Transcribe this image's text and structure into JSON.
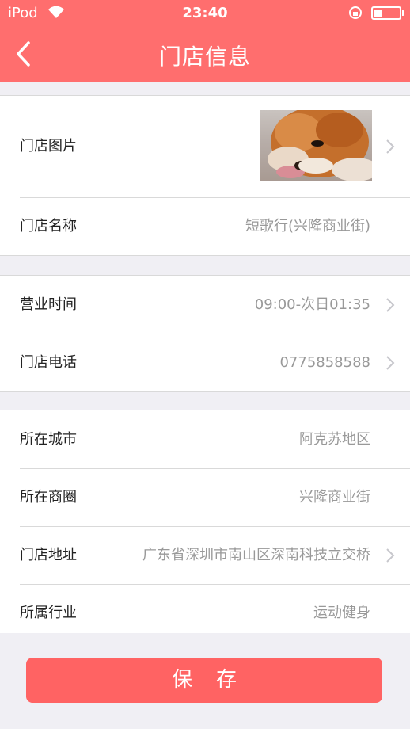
{
  "status_bar": {
    "carrier": "iPod",
    "time": "23:40"
  },
  "nav": {
    "title": "门店信息"
  },
  "groups": [
    [
      {
        "label": "门店图片",
        "value": "",
        "arrow": true
      },
      {
        "label": "门店名称",
        "value": "短歌行(兴隆商业街)",
        "arrow": false
      }
    ],
    [
      {
        "label": "营业时间",
        "value": "09:00-次日01:35",
        "arrow": true
      },
      {
        "label": "门店电话",
        "value": "0775858588",
        "arrow": true
      }
    ],
    [
      {
        "label": "所在城市",
        "value": "阿克苏地区",
        "arrow": false
      },
      {
        "label": "所在商圈",
        "value": "兴隆商业街",
        "arrow": false
      },
      {
        "label": "门店地址",
        "value": "广东省深圳市南山区深南科技立交桥",
        "arrow": true
      },
      {
        "label": "所属行业",
        "value": "运动健身",
        "arrow": false
      }
    ]
  ],
  "actions": {
    "save_label": "保存"
  },
  "colors": {
    "accent": "#ff6e6e",
    "save_button": "#ff6363",
    "background": "#f0eff4"
  }
}
